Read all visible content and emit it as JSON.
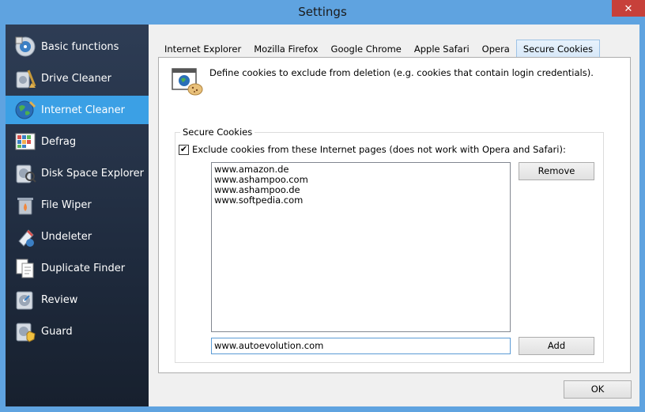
{
  "window": {
    "title": "Settings",
    "close_label": "✕"
  },
  "sidebar": {
    "items": [
      {
        "label": "Basic functions",
        "icon": "basic-functions-icon"
      },
      {
        "label": "Drive Cleaner",
        "icon": "drive-cleaner-icon"
      },
      {
        "label": "Internet Cleaner",
        "icon": "internet-cleaner-icon",
        "active": true
      },
      {
        "label": "Defrag",
        "icon": "defrag-icon"
      },
      {
        "label": "Disk Space Explorer",
        "icon": "disk-space-icon"
      },
      {
        "label": "File Wiper",
        "icon": "file-wiper-icon"
      },
      {
        "label": "Undeleter",
        "icon": "undeleter-icon"
      },
      {
        "label": "Duplicate Finder",
        "icon": "duplicate-finder-icon"
      },
      {
        "label": "Review",
        "icon": "review-icon"
      },
      {
        "label": "Guard",
        "icon": "guard-icon"
      }
    ]
  },
  "tabs": [
    {
      "label": "Internet Explorer"
    },
    {
      "label": "Mozilla Firefox"
    },
    {
      "label": "Google Chrome"
    },
    {
      "label": "Apple Safari"
    },
    {
      "label": "Opera"
    },
    {
      "label": "Secure Cookies",
      "active": true
    }
  ],
  "panel": {
    "description": "Define cookies to exclude from deletion (e.g. cookies that contain login credentials).",
    "group_title": "Secure Cookies",
    "checkbox_label": "Exclude cookies from these Internet pages (does not work with Opera and Safari):",
    "checkbox_checked": true,
    "sites": [
      "www.amazon.de",
      "www.ashampoo.com",
      "www.ashampoo.de",
      "www.softpedia.com"
    ],
    "remove_label": "Remove",
    "new_site_value": "www.autoevolution.com",
    "add_label": "Add"
  },
  "footer": {
    "ok_label": "OK"
  },
  "colors": {
    "accent": "#3ba0e5",
    "titlebar": "#5fa3e0",
    "close": "#c7403a",
    "sidebar": "#1f2b3e"
  }
}
